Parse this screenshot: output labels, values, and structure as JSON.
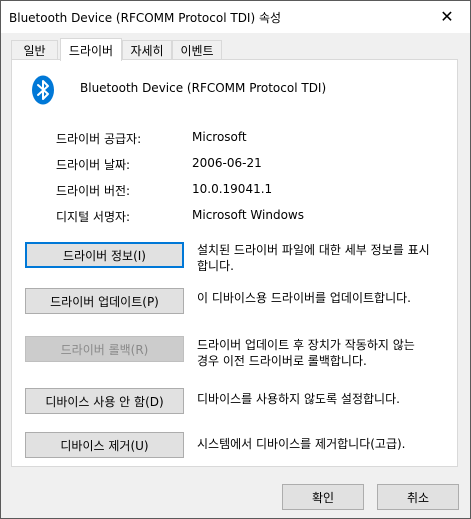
{
  "window": {
    "title": "Bluetooth Device (RFCOMM Protocol TDI) 속성"
  },
  "tabs": [
    {
      "label": "일반"
    },
    {
      "label": "드라이버"
    },
    {
      "label": "자세히"
    },
    {
      "label": "이벤트"
    }
  ],
  "device": {
    "name": "Bluetooth Device (RFCOMM Protocol TDI)",
    "icon": "bluetooth-icon",
    "icon_color": "#0078d7"
  },
  "info": [
    {
      "label": "드라이버 공급자:",
      "value": "Microsoft"
    },
    {
      "label": "드라이버 날짜:",
      "value": "2006-06-21"
    },
    {
      "label": "드라이버 버전:",
      "value": "10.0.19041.1"
    },
    {
      "label": "디지털 서명자:",
      "value": "Microsoft Windows"
    }
  ],
  "actions": [
    {
      "label": "드라이버 정보(I)",
      "desc1": "설치된 드라이버 파일에 대한 세부 정보를 표시",
      "desc2": "합니다."
    },
    {
      "label": "드라이버 업데이트(P)",
      "desc1": "이 디바이스용 드라이버를 업데이트합니다.",
      "desc2": ""
    },
    {
      "label": "드라이버 롤백(R)",
      "desc1": "드라이버 업데이트 후 장치가 작동하지 않는",
      "desc2": "경우 이전 드라이버로 롤백합니다."
    },
    {
      "label": "디바이스 사용 안 함(D)",
      "desc1": "디바이스를 사용하지 않도록 설정합니다.",
      "desc2": ""
    },
    {
      "label": "디바이스 제거(U)",
      "desc1": "시스템에서 디바이스를 제거합니다(고급).",
      "desc2": ""
    }
  ],
  "footer": {
    "ok_label": "확인",
    "cancel_label": "취소"
  },
  "colors": {
    "focus_border": "#0078d7",
    "disabled_text": "#8a8a8a"
  }
}
